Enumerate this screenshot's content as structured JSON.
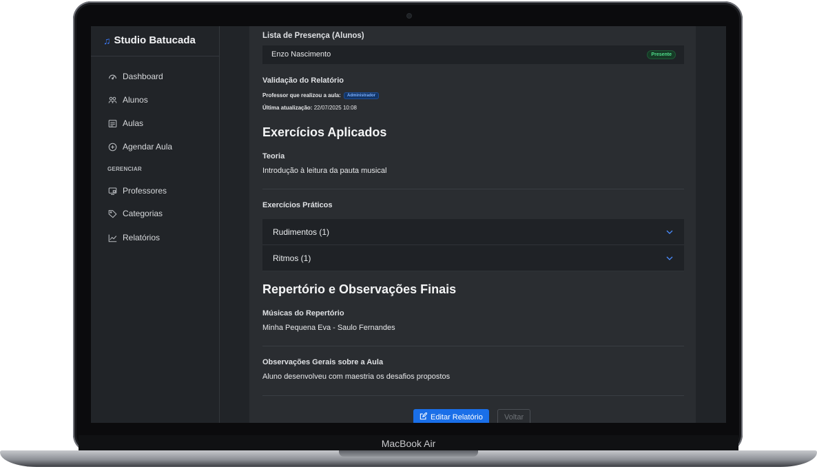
{
  "device": {
    "label": "MacBook Air"
  },
  "app": {
    "logo_icon": "music-note-icon",
    "name": "Studio Batucada",
    "accent": "#1a6fe8"
  },
  "sidebar": {
    "items": [
      {
        "icon": "dashboard-icon",
        "label": "Dashboard"
      },
      {
        "icon": "users-icon",
        "label": "Alunos"
      },
      {
        "icon": "calendar-list-icon",
        "label": "Aulas"
      },
      {
        "icon": "plus-circle-icon",
        "label": "Agendar Aula"
      }
    ],
    "section_label": "GERENCIAR",
    "manage_items": [
      {
        "icon": "monitor-icon",
        "label": "Professores"
      },
      {
        "icon": "tag-icon",
        "label": "Categorias"
      },
      {
        "icon": "chart-line-icon",
        "label": "Relatórios"
      }
    ]
  },
  "attendance": {
    "title": "Lista de Presença (Alunos)",
    "student": "Enzo Nascimento",
    "status": "Presente"
  },
  "validation": {
    "title": "Validação do Relatório",
    "teacher_label": "Professor que realizou a aula:",
    "teacher_role": "Administrador",
    "updated_label": "Última atualização:",
    "updated_value": "22/07/2025 10:08"
  },
  "exercises": {
    "title": "Exercícios Aplicados",
    "theory_label": "Teoria",
    "theory_text": "Introdução à leitura da pauta musical",
    "practical_label": "Exercícios Práticos",
    "accordion": [
      {
        "label": "Rudimentos (1)"
      },
      {
        "label": "Ritmos (1)"
      }
    ]
  },
  "repertoire": {
    "title": "Repertório e Observações Finais",
    "songs_label": "Músicas do Repertório",
    "songs_text": "Minha Pequena Eva - Saulo Fernandes",
    "notes_label": "Observações Gerais sobre a Aula",
    "notes_text": "Aluno desenvolveu com maestria os desafios propostos"
  },
  "actions": {
    "edit_label": "Editar Relatório",
    "back_label": "Voltar"
  }
}
